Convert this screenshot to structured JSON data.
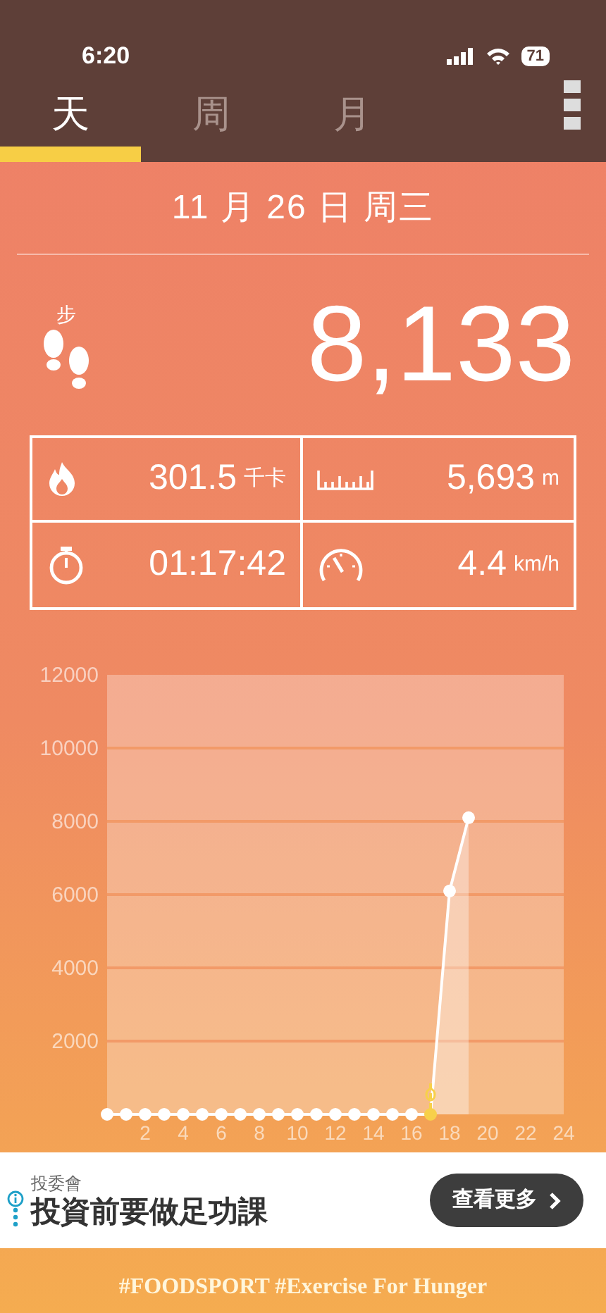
{
  "status_bar": {
    "time": "6:20",
    "battery": "71"
  },
  "tabs": [
    {
      "label": "天",
      "selected": true
    },
    {
      "label": "周",
      "selected": false
    },
    {
      "label": "月",
      "selected": false
    }
  ],
  "date": "11 月 26 日 周三",
  "steps": {
    "label": "步",
    "value": "8,133"
  },
  "stats": [
    {
      "kind": "calories",
      "value": "301.5",
      "unit": "千卡"
    },
    {
      "kind": "distance",
      "value": "5,693",
      "unit": "m"
    },
    {
      "kind": "duration",
      "value": "01:17:42"
    },
    {
      "kind": "speed",
      "value": "4.4",
      "unit": "km/h"
    }
  ],
  "chart_data": {
    "type": "area",
    "grid": true,
    "x": [
      0,
      1,
      2,
      3,
      4,
      5,
      6,
      7,
      8,
      9,
      10,
      11,
      12,
      13,
      14,
      15,
      16,
      17,
      18,
      19
    ],
    "series": [
      {
        "color": "#ffffff",
        "marker": "circle",
        "values": [
          0,
          0,
          0,
          0,
          0,
          0,
          0,
          0,
          0,
          0,
          0,
          0,
          0,
          0,
          0,
          0,
          0,
          0,
          6100,
          8100
        ]
      }
    ],
    "xlim": [
      0,
      24
    ],
    "ylim": [
      0,
      12000
    ],
    "xticks": [
      2,
      4,
      6,
      8,
      10,
      12,
      14,
      16,
      18,
      20,
      22,
      24
    ],
    "yticks": [
      2000,
      4000,
      6000,
      8000,
      10000,
      12000
    ]
  },
  "ad": {
    "sponsor": "投委會",
    "title": "投資前要做足功課",
    "button": "查看更多"
  },
  "footer": "#FOODSPORT #Exercise For Hunger"
}
